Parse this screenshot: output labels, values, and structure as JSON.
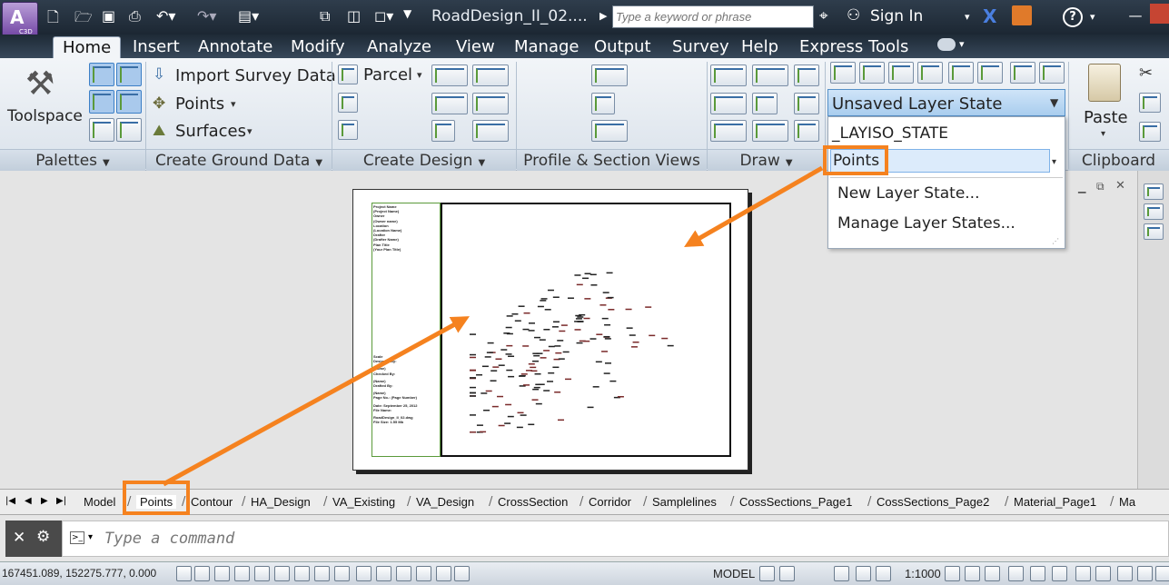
{
  "app": {
    "badge": "C3D",
    "title": "RoadDesign_II_02....",
    "search_placeholder": "Type a keyword or phrase",
    "sign_in": "Sign In"
  },
  "tabs": [
    "Home",
    "Insert",
    "Annotate",
    "Modify",
    "Analyze",
    "View",
    "Manage",
    "Output",
    "Survey",
    "Help",
    "Express Tools"
  ],
  "ribbon": {
    "toolspace": "Toolspace",
    "import_survey": "Import Survey Data",
    "points": "Points",
    "surfaces": "Surfaces",
    "parcel": "Parcel",
    "paste": "Paste",
    "layer_state": "Unsaved Layer State",
    "panels": [
      "Palettes",
      "Create Ground Data",
      "Create Design",
      "Profile & Section Views",
      "Draw",
      "Clipboard"
    ]
  },
  "layer_dropdown": {
    "items": [
      "_LAYISO_STATE",
      "Points"
    ],
    "actions": [
      "New Layer State...",
      "Manage Layer States..."
    ]
  },
  "layout_tabs": [
    "Model",
    "Points",
    "Contour",
    "HA_Design",
    "VA_Existing",
    "VA_Design",
    "CrossSection",
    "Corridor",
    "Samplelines",
    "CossSections_Page1",
    "CossSections_Page2",
    "Material_Page1",
    "Ma"
  ],
  "command": {
    "placeholder": "Type a command"
  },
  "status": {
    "coords": "167451.089, 152275.777, 0.000",
    "model": "MODEL",
    "scale": "1:1000"
  },
  "titleblock": [
    "Project Name",
    "(Project Name)",
    "Owner",
    "(Owner name)",
    "Location",
    "(Location Name)",
    "Drafter",
    "(Drafter Name)",
    "Plan Title",
    "(Your Plan Title)"
  ],
  "titleblock_bottom": [
    "Scale",
    "Designed By:",
    "(Name)",
    "Checked By:",
    "(Name)",
    "Drafted By:",
    "(Name)",
    "Page No.: (Page Number)",
    "Date: September 25, 2012",
    "File Name:",
    "RoadDesign_II_02.dwg",
    "File Size: 1.55 Mb"
  ],
  "colors": {
    "accent": "#f5821f",
    "ribbon_bg": "#dfe6ee",
    "canvas": "#e8e8e8",
    "title_bar": "#1f2c3a"
  }
}
